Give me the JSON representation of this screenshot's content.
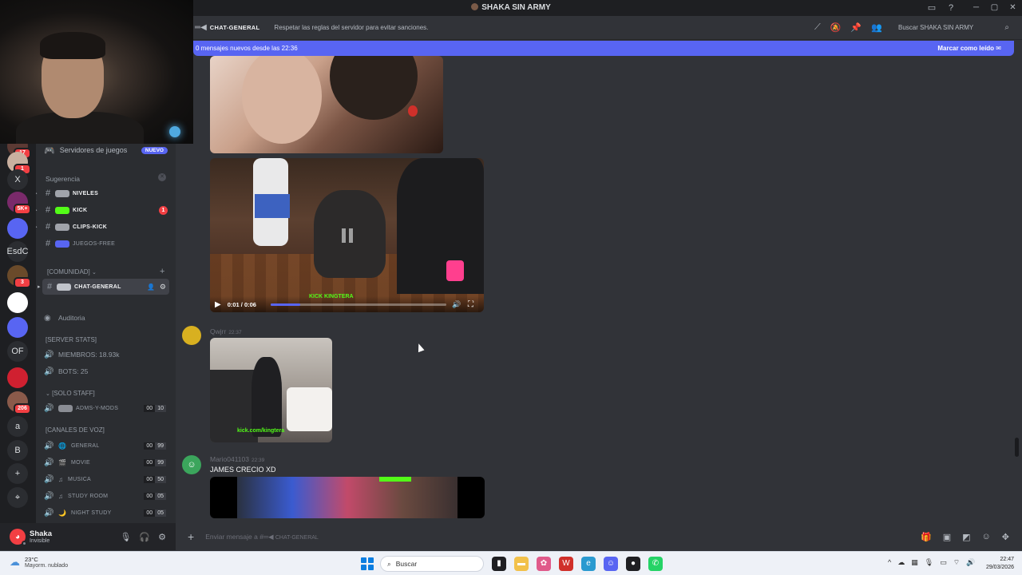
{
  "window": {
    "title": "SHAKA SIN ARMY"
  },
  "webcam": {
    "label": "streamer-webcam"
  },
  "rail": {
    "items": [
      {
        "id": "server-1",
        "badge": "17",
        "color": "#5c3a34"
      },
      {
        "id": "server-2",
        "badge": "1",
        "color": "#c9b0a0"
      },
      {
        "id": "server-x",
        "label": "X",
        "color": "#2b2d31"
      },
      {
        "id": "server-3",
        "badge": "5K+",
        "color": "#7a2a6a"
      },
      {
        "id": "folder-1",
        "color": "#5865f2"
      },
      {
        "id": "server-esdc",
        "label": "EsdC",
        "color": "#2b2d31"
      },
      {
        "id": "server-4",
        "badge": "3",
        "color": "#6a4a2a"
      },
      {
        "id": "server-5",
        "color": "#ffffff"
      },
      {
        "id": "folder-2",
        "color": "#5865f2"
      },
      {
        "id": "server-of",
        "label": "OF",
        "color": "#2b2d31"
      },
      {
        "id": "server-6",
        "color": "#d02030"
      },
      {
        "id": "server-7",
        "badge": "206",
        "color": "#8a5a4a"
      },
      {
        "id": "server-a",
        "label": "a",
        "color": "#2b2d31"
      },
      {
        "id": "server-b",
        "label": "B",
        "color": "#2b2d31"
      },
      {
        "id": "add-server",
        "label": "+",
        "color": "#2b2d31"
      },
      {
        "id": "explore",
        "label": "⌖",
        "color": "#2b2d31"
      }
    ]
  },
  "sidebar": {
    "game_servers": "Servidores de juegos",
    "nuevo": "NUEVO",
    "suggestion": "Sugerencia",
    "channels_top": [
      {
        "name": "NIVELES",
        "bold": true,
        "emoji_color": "#a0a3aa"
      },
      {
        "name": "KICK",
        "bold": true,
        "emoji_color": "#53fc18",
        "badge": "1"
      },
      {
        "name": "CLIPS-KICK",
        "bold": true,
        "emoji_color": "#a0a3aa"
      },
      {
        "name": "JUEGOS-FREE",
        "bold": false,
        "emoji_color": "#5865f2"
      }
    ],
    "community_cat": "[COMUNIDAD]",
    "active_channel": "CHAT-GENERAL",
    "audit": "Auditoria",
    "stats_cat": "[SERVER STATS]",
    "members": "MIEMBROS: 18.93k",
    "bots": "BOTS: 25",
    "staff_cat": "[SOLO STAFF]",
    "staff_channel": {
      "name": "ADMS-Y-MODS",
      "c1": "00",
      "c2": "10"
    },
    "voice_cat": "[CANALES DE VOZ]",
    "voice_channels": [
      {
        "name": "GENERAL",
        "c1": "00",
        "c2": "99",
        "icon": "🌐"
      },
      {
        "name": "MOVIE",
        "c1": "00",
        "c2": "99",
        "icon": "🎬"
      },
      {
        "name": "MUSICA",
        "c1": "00",
        "c2": "50",
        "icon": "♫"
      },
      {
        "name": "STUDY ROOM",
        "c1": "00",
        "c2": "05",
        "icon": "♫"
      },
      {
        "name": "NIGHT STUDY",
        "c1": "00",
        "c2": "05",
        "icon": "🌙"
      }
    ]
  },
  "user": {
    "name": "Shaka",
    "status": "Invisible"
  },
  "header": {
    "channel": "CHAT-GENERAL",
    "topic": "Respetar las reglas del servidor para evitar sanciones.",
    "search_placeholder": "Buscar SHAKA SIN ARMY"
  },
  "newbar": {
    "left": "0 mensajes nuevos desde las 22:36",
    "right": "Marcar como leído"
  },
  "video": {
    "time": "0:01 / 0:06",
    "progress": 0.17,
    "watermark": "KICK KINGTERA"
  },
  "messages": [
    {
      "author": "Qwjrr",
      "time": "22:37",
      "avatar_color": "#d8b020",
      "watermark": "kick.com/kingtera"
    },
    {
      "author": "Mario041103",
      "time": "22:39",
      "avatar_color": "#3ba55c",
      "text": "JAMES CRECIO XD"
    }
  ],
  "composer": {
    "placeholder_prefix": "Enviar mensaje a #",
    "placeholder_channel": "CHAT-GENERAL"
  },
  "taskbar": {
    "temp": "23°C",
    "weather": "Mayorm. nublado",
    "search": "Buscar",
    "time": "22:47",
    "date": "29/03/2026"
  }
}
